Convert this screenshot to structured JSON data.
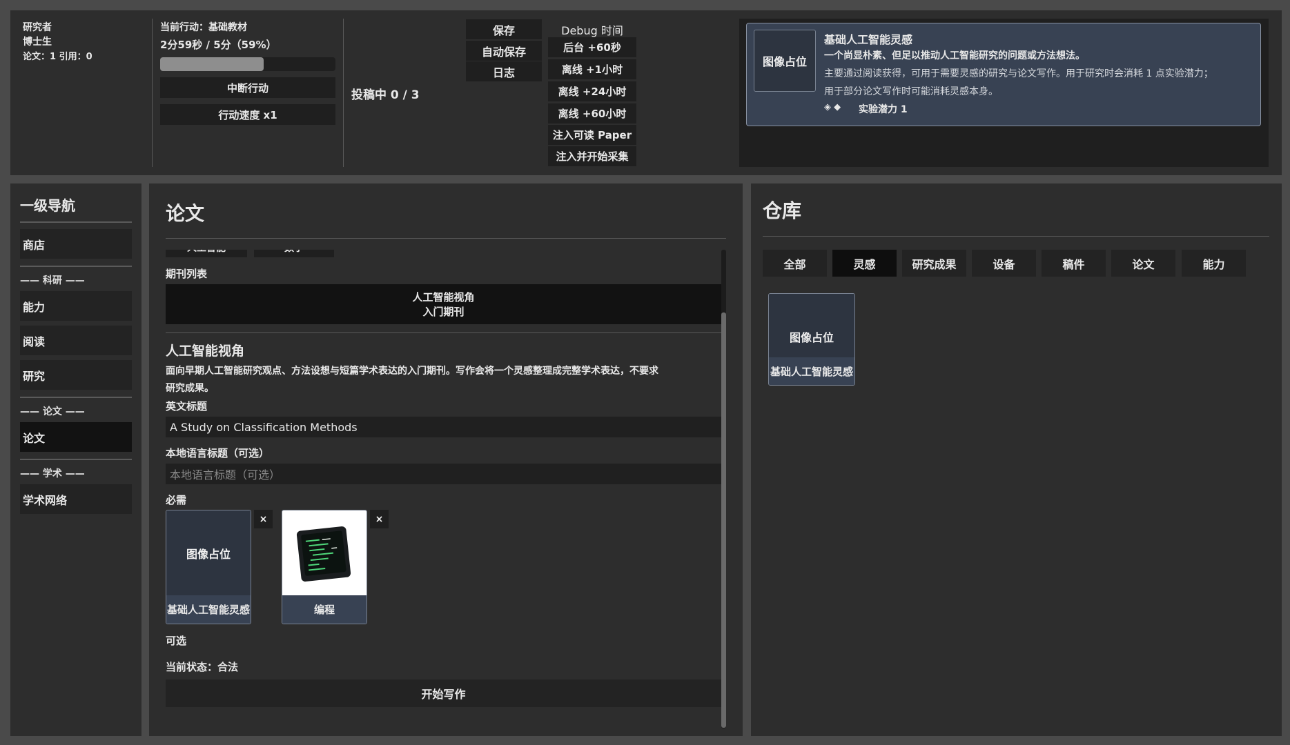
{
  "player": {
    "role": "研究者",
    "degree": "博士生",
    "stats": "论文：1  引用：0"
  },
  "action": {
    "current": "当前行动：基础教材",
    "time": "2分59秒 / 5分（59%）",
    "progress": 0.59,
    "interrupt": "中断行动",
    "speed": "行动速度 x1"
  },
  "submission": "投稿中 0 / 3",
  "system": {
    "save": "保存",
    "autosave": "自动保存",
    "log": "日志"
  },
  "debug": {
    "title": "Debug 时间",
    "buttons": [
      "后台 +60秒",
      "离线 +1小时",
      "离线 +24小时",
      "离线 +60小时",
      "注入可读 Paper",
      "注入并开始采集"
    ]
  },
  "tooltip": {
    "image": "图像占位",
    "title": "基础人工智能灵感",
    "subtitle": "一个尚显朴素、但足以推动人工智能研究的问题或方法想法。",
    "desc1": "主要通过阅读获得，可用于需要灵感的研究与论文写作。用于研究时会消耗 1 点实验潜力；",
    "desc2": "用于部分论文写作时可能消耗灵感本身。",
    "bullets": "◈  ◆",
    "attr": "实验潜力 1"
  },
  "nav": {
    "title": "一级导航",
    "shop": "商店",
    "sec_research": "—— 科研 ——",
    "ability": "能力",
    "reading": "阅读",
    "research": "研究",
    "sec_paper": "—— 论文 ——",
    "paper": "论文",
    "sec_academic": "—— 学术 ——",
    "network": "学术网络"
  },
  "paper": {
    "title": "论文",
    "top_tabs": [
      "人工智能",
      "数学"
    ],
    "journal_list_label": "期刊列表",
    "journal_line1": "人工智能视角",
    "journal_line2": "入门期刊",
    "journal_name": "人工智能视角",
    "journal_desc1": "面向早期人工智能研究观点、方法设想与短篇学术表达的入门期刊。写作会将一个灵感整理成完整学术表达，不要求",
    "journal_desc2": "研究成果。",
    "en_title_label": "英文标题",
    "en_title_value": "A Study on Classification Methods",
    "local_title_label": "本地语言标题（可选）",
    "local_title_placeholder": "本地语言标题（可选）",
    "required_label": "必需",
    "required_items": [
      {
        "image": "图像占位",
        "name": "基础人工智能灵感"
      },
      {
        "image": "",
        "name": "编程"
      }
    ],
    "remove": "×",
    "optional_label": "可选",
    "status": "当前状态：合法",
    "start": "开始写作"
  },
  "warehouse": {
    "title": "仓库",
    "tabs": [
      "全部",
      "灵感",
      "研究成果",
      "设备",
      "稿件",
      "论文",
      "能力"
    ],
    "active_tab": "灵感",
    "items": [
      {
        "image": "图像占位",
        "name": "基础人工智能灵感"
      }
    ]
  }
}
